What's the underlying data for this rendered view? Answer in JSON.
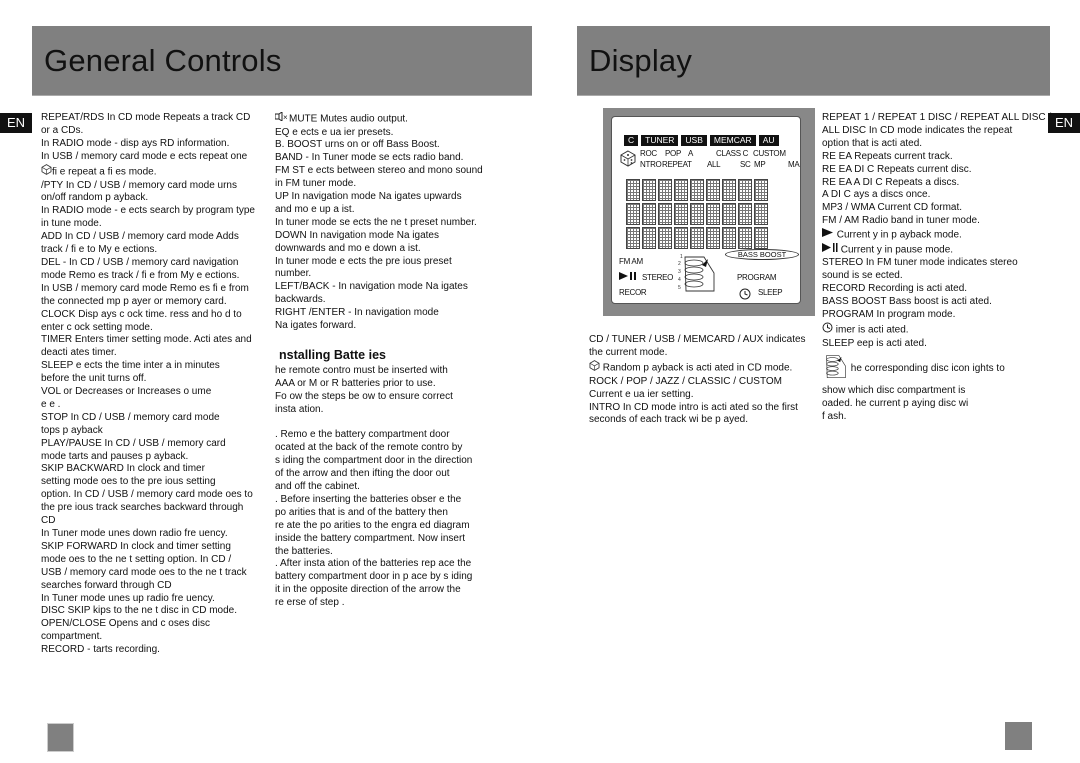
{
  "left_page": {
    "title": "General Controls",
    "lang_badge": "EN",
    "col1": [
      "REPEAT/RDS  In CD mode   Repeats a track  CD",
      "or a   CDs.",
      "In RADIO mode - disp ays RD   information.",
      "In USB / memory card mode     e ects repeat one",
      "fi e  repeat a   fi es mode.",
      "/PTY  In CD / USB / memory card mode     urns",
      "on/off random p ayback.",
      "In RADIO mode -   e ects search  by program type",
      "in tune mode.",
      "ADD    In CD / USB / memory card mode    Adds",
      "track / fi e to My   e ections.",
      "DEL -  In CD / USB / memory card navigation",
      "mode    Remo es track / fi e from My   e ections.",
      "In USB / memory card mode   Remo es fi e from",
      "the connected mp   p ayer or memory card.",
      "CLOCK  Disp ays c ock time.   ress and ho d to",
      "enter c ock setting mode.",
      "TIMER   Enters timer setting mode. Acti  ates and",
      "deacti  ates timer.",
      "SLEEP    e ects the time inter  a  in minutes",
      "before the unit turns off.",
      "VOL   or      Decreases or Increases  o ume",
      " e e .",
      "STOP       In CD / USB / memory card mode",
      " tops p ayback",
      "PLAY/PAUSE        In CD / USB / memory card",
      "mode    tarts and pauses p ayback.",
      "SKIP BACKWARD        In clock and timer",
      "setting mode      oes to the pre  ious setting",
      "option. In CD / USB / memory card mode     oes to",
      "the pre  ious track  searches backward through",
      "CD",
      "In Tuner mode     unes down radio fre  uency.",
      "SKIP FORWARD        In clock and timer setting",
      "mode     oes to the ne  t setting option. In CD /",
      "USB / memory card mode      oes to the ne  t track",
      "searches forward through CD",
      "In Tuner mode     unes up radio fre  uency.",
      "DISC SKIP    kips to the ne  t disc in CD mode.",
      "OPEN/CLOSE   Opens and c oses disc",
      "compartment.",
      "RECORD -  tarts recording."
    ],
    "col2": [
      "MUTE   Mutes audio output.",
      "EQ     e ects e  ua ier presets.",
      "B. BOOST    urns on or off Bass Boost.",
      "BAND  - In Tuner mode    se ects radio band.",
      "FM ST     e ects between stereo and mono sound",
      "in FM tuner mode.",
      "UP       In navigation mode     Na  igates upwards",
      "and mo  e up a  ist.",
      "In tuner mode    se ects the ne  t preset number.",
      "DOWN       In navigation mode     Na  igates",
      "downwards and mo  e down a  ist.",
      "In tuner mode      e ects the pre  ious preset",
      "number.",
      "LEFT/BACK     - In navigation mode     Na  igates",
      "backwards.",
      "RIGHT /ENTER      - In navigation mode",
      "Na  igates forward."
    ],
    "batteries_heading": "nstalling Batte ies",
    "batteries_intro": [
      " he remote contro  must be inserted with",
      " AAA  or     M     or  R      batteries prior to use.",
      "Fo  ow the steps be ow to ensure correct",
      "insta  ation."
    ],
    "battery_steps": [
      ".  Remo  e the battery compartment door",
      "    ocated at the back of the remote contro   by",
      "   s iding the compartment door in the direction",
      "   of the arrow and then  ifting the door out",
      "   and off the cabinet.",
      ".  Before inserting the batteries  obser  e the",
      "   po arities  that is     and     of the battery  then",
      "   re ate the po arities to the engra  ed diagram",
      "   inside the battery compartment.  Now insert",
      "   the batteries.",
      ".  After insta  ation of the batteries  rep ace the",
      "   battery compartment door in p ace by s iding",
      "   it  in the opposite direction of the arrow  the",
      "   re  erse of step    ."
    ]
  },
  "right_page": {
    "title": "Display",
    "lang_badge": "EN",
    "lcd": {
      "sources": [
        "C",
        "TUNER",
        "USB",
        "MEMCAR",
        "AU"
      ],
      "eq_row": [
        "ROC",
        "POP",
        "A",
        "CLASS C",
        "CUSTOM"
      ],
      "mode_row": [
        "NTRO",
        "REPEAT",
        "ALL",
        "SC",
        "MP",
        "MA"
      ],
      "band": "FM AM",
      "stereo": "STEREO",
      "record": "RECOR",
      "bass_boost": "BASS BOOST",
      "program": "PROGRAM",
      "sleep": "SLEEP",
      "disc_numbers": [
        "1",
        "2",
        "3",
        "4",
        "5"
      ]
    },
    "col3": [
      "CD / TUNER / USB / MEMCARD / AUX     indicates",
      "the current mode.",
      "     Random p ayback is acti  ated in CD mode.",
      "ROCK / POP / JAZZ / CLASSIC / CUSTOM",
      "Current e  ua ier setting.",
      "INTRO   In CD mode  intro is acti  ated so the first",
      "   seconds of each track wi   be p ayed."
    ],
    "col4": [
      "REPEAT 1 / REPEAT 1 DISC / REPEAT ALL DISC /",
      "ALL DISC    In CD mode  indicates the repeat",
      "option that is acti  ated.",
      "RE  EA        Repeats current track.",
      "RE  EA      DI  C   Repeats current disc.",
      "RE  EA   A     DI  C   Repeats a   discs.",
      "A     DI  C      ays a   discs once.",
      "MP3 / WMA     Current CD format.",
      "FM / AM     Radio band in tuner mode.",
      "      Current y in p ayback mode.",
      "      Current y in pause mode.",
      "STEREO   In FM tuner mode  indicates stereo",
      "sound is se ected.",
      "RECORD   Recording is acti  ated.",
      "BASS BOOST   Bass boost is acti  ated.",
      "PROGRAM    In program mode.",
      "      imer is acti  ated.",
      "SLEEP     eep is acti  ated.",
      "         he corresponding disc icon  ights to",
      "         show which disc compartment is",
      "          oaded.   he current p aying disc wi",
      "         f ash."
    ]
  },
  "icons": {
    "random": "random-dice-icon",
    "mute": "speaker-mute-icon",
    "play": "play-icon",
    "pause": "pause-icon",
    "clock": "clock-icon",
    "disc_stack": "disc-stack-icon"
  }
}
